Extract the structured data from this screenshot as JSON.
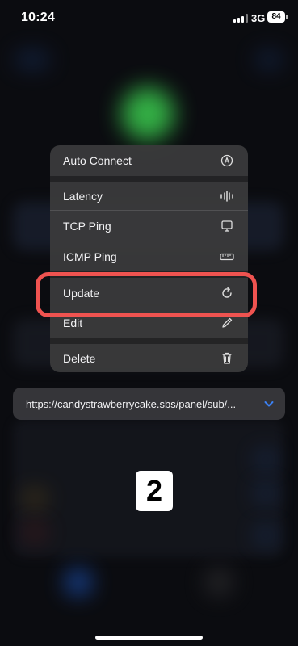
{
  "status_bar": {
    "time": "10:24",
    "network": "3G",
    "battery": "84"
  },
  "context_menu": {
    "items": [
      {
        "label": "Auto Connect",
        "icon": "auto-connect-icon"
      },
      {
        "label": "Latency",
        "icon": "latency-icon"
      },
      {
        "label": "TCP Ping",
        "icon": "monitor-icon"
      },
      {
        "label": "ICMP Ping",
        "icon": "ruler-icon"
      },
      {
        "label": "Update",
        "icon": "refresh-icon"
      },
      {
        "label": "Edit",
        "icon": "pencil-icon"
      },
      {
        "label": "Delete",
        "icon": "trash-icon"
      }
    ]
  },
  "subscription": {
    "url": "https://candystrawberrycake.sbs/panel/sub/...",
    "accent_color": "#3b82f6"
  },
  "annotation": {
    "step_number": "2",
    "highlight_color": "#ef5350"
  }
}
